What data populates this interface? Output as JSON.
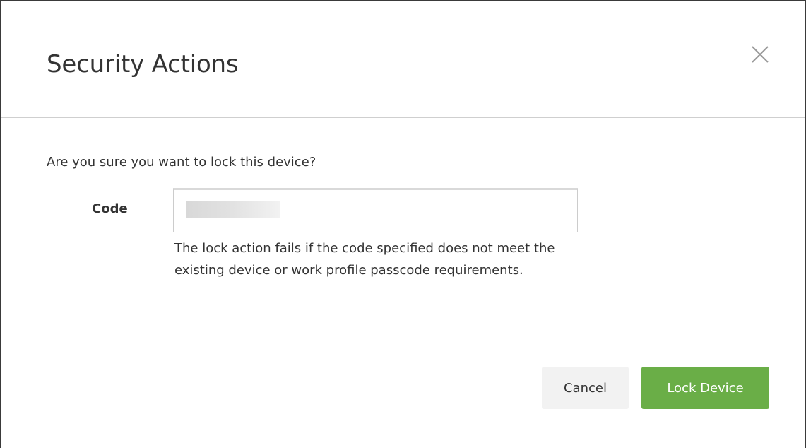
{
  "dialog": {
    "title": "Security Actions",
    "close_icon": "close-icon",
    "question": "Are you sure you want to lock this device?",
    "code_field": {
      "label": "Code",
      "value": "",
      "help_text": "The lock action fails if the code specified does not meet the existing device or work profile passcode requirements."
    },
    "buttons": {
      "cancel_label": "Cancel",
      "lock_label": "Lock Device"
    }
  },
  "colors": {
    "primary_button": "#6aae47",
    "secondary_button": "#f2f2f2",
    "divider": "#cfcfcf"
  }
}
